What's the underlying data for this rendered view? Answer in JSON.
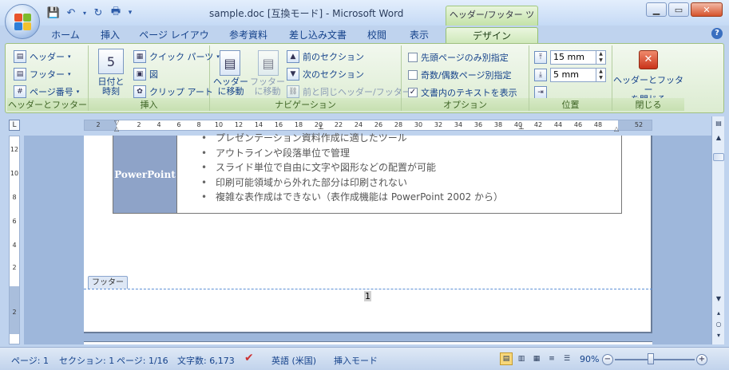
{
  "window": {
    "title": "sample.doc [互換モード] - Microsoft Word",
    "context_tab": "ヘッダー/フッター ツール"
  },
  "tabs": [
    "ホーム",
    "挿入",
    "ページ レイアウト",
    "参考資料",
    "差し込み文書",
    "校閲",
    "表示",
    "デザイン"
  ],
  "active_tab": "デザイン",
  "ribbon": {
    "group_hf": {
      "label": "ヘッダーとフッター",
      "header": "ヘッダー",
      "footer": "フッター",
      "page_number": "ページ番号"
    },
    "group_insert": {
      "label": "挿入",
      "datetime_line1": "日付と",
      "datetime_line2": "時刻",
      "quick_parts": "クイック パーツ",
      "picture": "図",
      "clipart": "クリップ アート"
    },
    "group_nav": {
      "label": "ナビゲーション",
      "goto_header_line1": "ヘッダー",
      "goto_header_line2": "に移動",
      "goto_footer_line1": "フッター",
      "goto_footer_line2": "に移動",
      "prev_section": "前のセクション",
      "next_section": "次のセクション",
      "link_previous": "前と同じヘッダー/フッター"
    },
    "group_options": {
      "label": "オプション",
      "first_page": "先頭ページのみ別指定",
      "odd_even": "奇数/偶数ページ別指定",
      "show_text": "文書内のテキストを表示",
      "first_page_checked": false,
      "odd_even_checked": false,
      "show_text_checked": true
    },
    "group_position": {
      "label": "位置",
      "header_pos": "15 mm",
      "footer_pos": "5 mm"
    },
    "group_close": {
      "label": "閉じる",
      "close_line1": "ヘッダーとフッター",
      "close_line2": "を閉じる"
    }
  },
  "ruler": {
    "h_ticks": [
      "2",
      "2",
      "4",
      "6",
      "8",
      "10",
      "12",
      "14",
      "16",
      "18",
      "20",
      "22",
      "24",
      "26",
      "28",
      "30",
      "32",
      "34",
      "36",
      "38",
      "40",
      "42",
      "44",
      "46",
      "48",
      "52"
    ],
    "v_ticks": [
      "12",
      "10",
      "8",
      "6",
      "4",
      "2",
      "2"
    ]
  },
  "document": {
    "table_label": "PowerPoint",
    "bullets": [
      "プレゼンテーション資料作成に適したツール",
      "アウトラインや段落単位で管理",
      "スライド単位で自由に文字や図形などの配置が可能",
      "印刷可能領域から外れた部分は印刷されない",
      "複雑な表作成はできない（表作成機能は PowerPoint 2002 から）"
    ],
    "footer_tag": "フッター",
    "page_number": "1"
  },
  "status": {
    "page": "ページ: 1",
    "section": "セクション: 1",
    "page_of": "ページ: 1/16",
    "word_count": "文字数: 6,173",
    "language": "英語 (米国)",
    "mode": "挿入モード",
    "zoom": "90%"
  }
}
